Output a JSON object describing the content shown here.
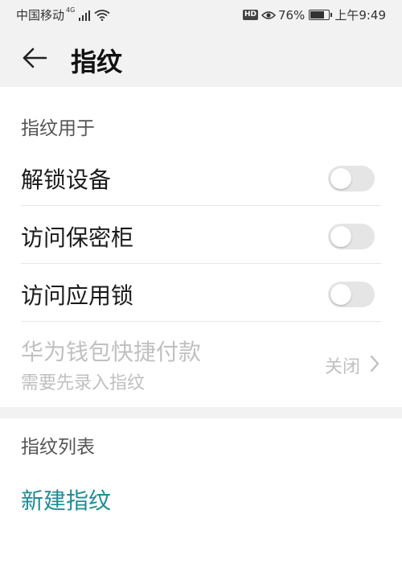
{
  "status_bar": {
    "carrier": "中国移动",
    "network": "4G",
    "battery": "76%",
    "battery_level": 0.76,
    "time": "上午9:49",
    "hd_badge": "HD"
  },
  "header": {
    "title": "指纹"
  },
  "usage_section": {
    "title": "指纹用于",
    "items": [
      {
        "label": "解锁设备",
        "enabled": false
      },
      {
        "label": "访问保密柜",
        "enabled": false
      },
      {
        "label": "访问应用锁",
        "enabled": false
      }
    ],
    "wallet": {
      "label": "华为钱包快捷付款",
      "subtitle": "需要先录入指纹",
      "value": "关闭"
    }
  },
  "list_section": {
    "title": "指纹列表",
    "new_fingerprint": "新建指纹"
  },
  "colors": {
    "accent": "#1f8c94",
    "header_bg": "#f2f2f2",
    "toggle_off": "#e5e5e5",
    "disabled_text": "#c0c0c0"
  }
}
